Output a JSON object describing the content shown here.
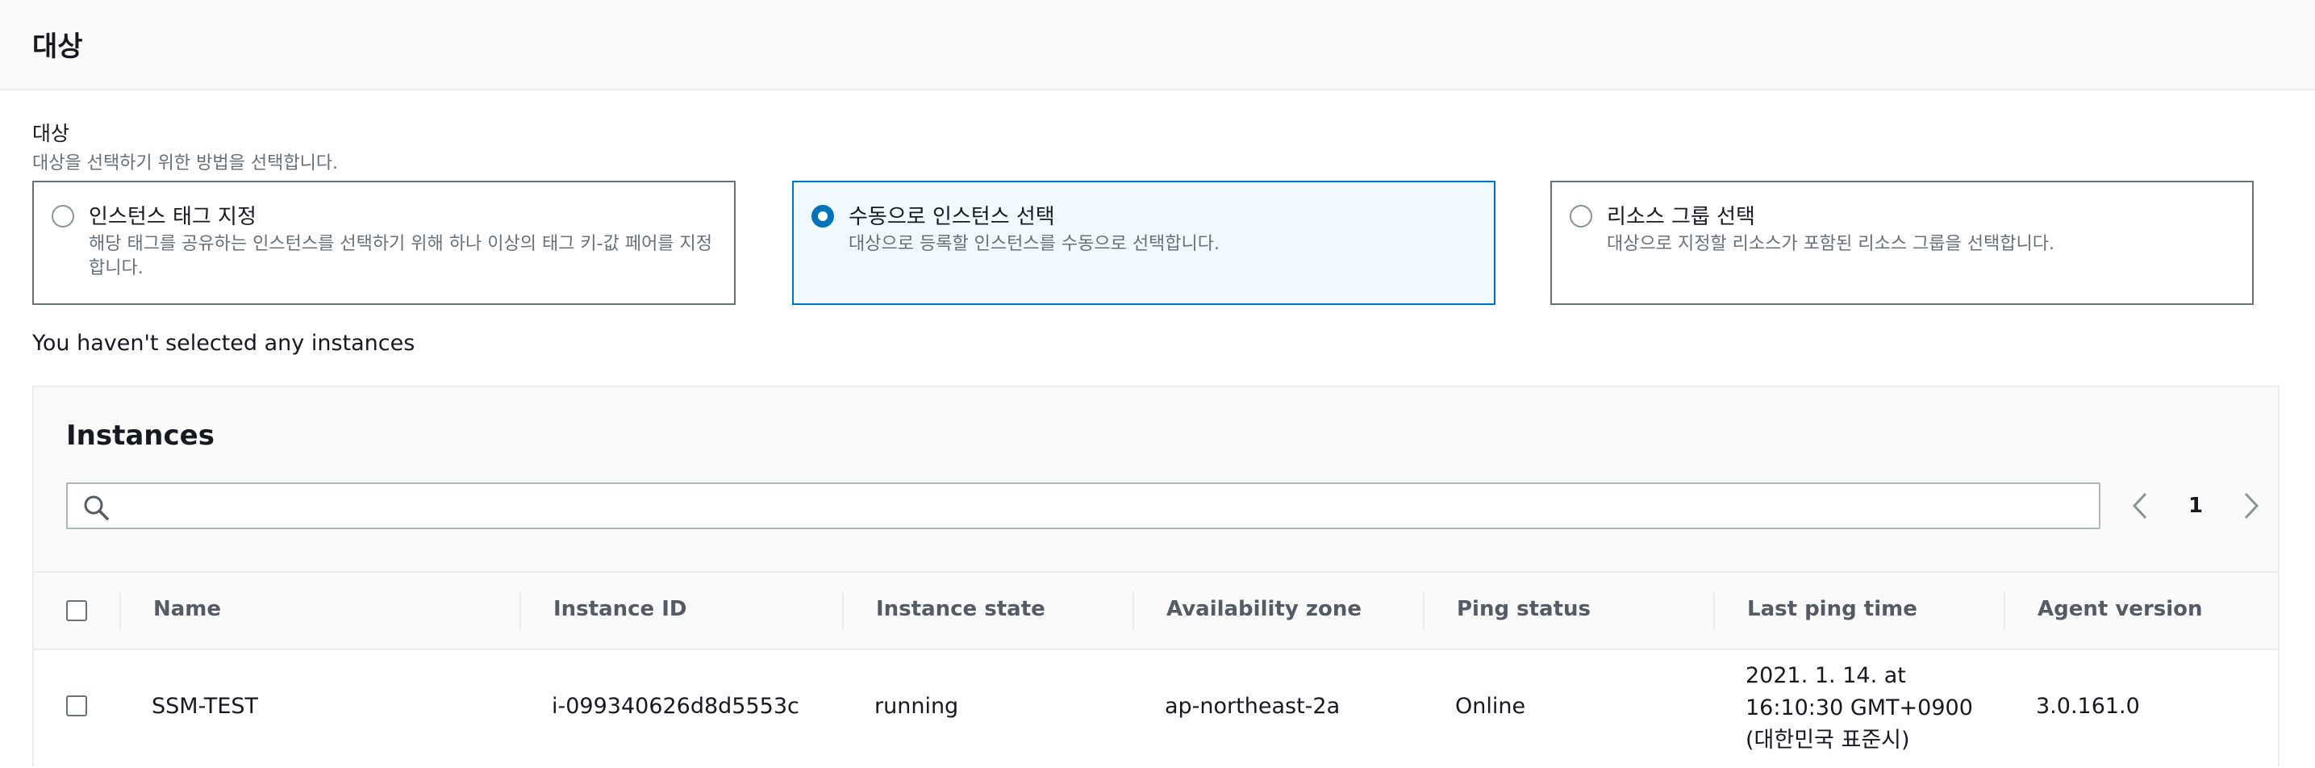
{
  "header": {
    "title": "대상"
  },
  "targets": {
    "label": "대상",
    "description": "대상을 선택하기 위한 방법을 선택합니다.",
    "options": [
      {
        "title": "인스턴스 태그 지정",
        "description": "해당 태그를 공유하는 인스턴스를 선택하기 위해 하나 이상의 태그 키-값 페어를 지정합니다.",
        "selected": false
      },
      {
        "title": "수동으로 인스턴스 선택",
        "description": "대상으로 등록할 인스턴스를 수동으로 선택합니다.",
        "selected": true
      },
      {
        "title": "리소스 그룹 선택",
        "description": "대상으로 지정할 리소스가 포함된 리소스 그룹을 선택합니다.",
        "selected": false
      }
    ]
  },
  "no_selection_text": "You haven't selected any instances",
  "instances": {
    "title": "Instances",
    "search": {
      "value": "",
      "placeholder": ""
    },
    "pagination": {
      "current_page": "1"
    },
    "columns": [
      "Name",
      "Instance ID",
      "Instance state",
      "Availability zone",
      "Ping status",
      "Last ping time",
      "Agent version"
    ],
    "rows": [
      {
        "name": "SSM-TEST",
        "instance_id": "i-099340626d8d5553c",
        "instance_state": "running",
        "availability_zone": "ap-northeast-2a",
        "ping_status": "Online",
        "last_ping_time": "2021. 1. 14. at 16:10:30 GMT+0900 (대한민국 표준시)",
        "agent_version": "3.0.161.0"
      }
    ]
  },
  "colors": {
    "accent": "#0073bb",
    "selected_bg": "#f1faff",
    "border": "#687078",
    "muted_text": "#687078"
  },
  "icons": {
    "search": "search-icon",
    "prev": "chevron-left-icon",
    "next": "chevron-right-icon"
  }
}
